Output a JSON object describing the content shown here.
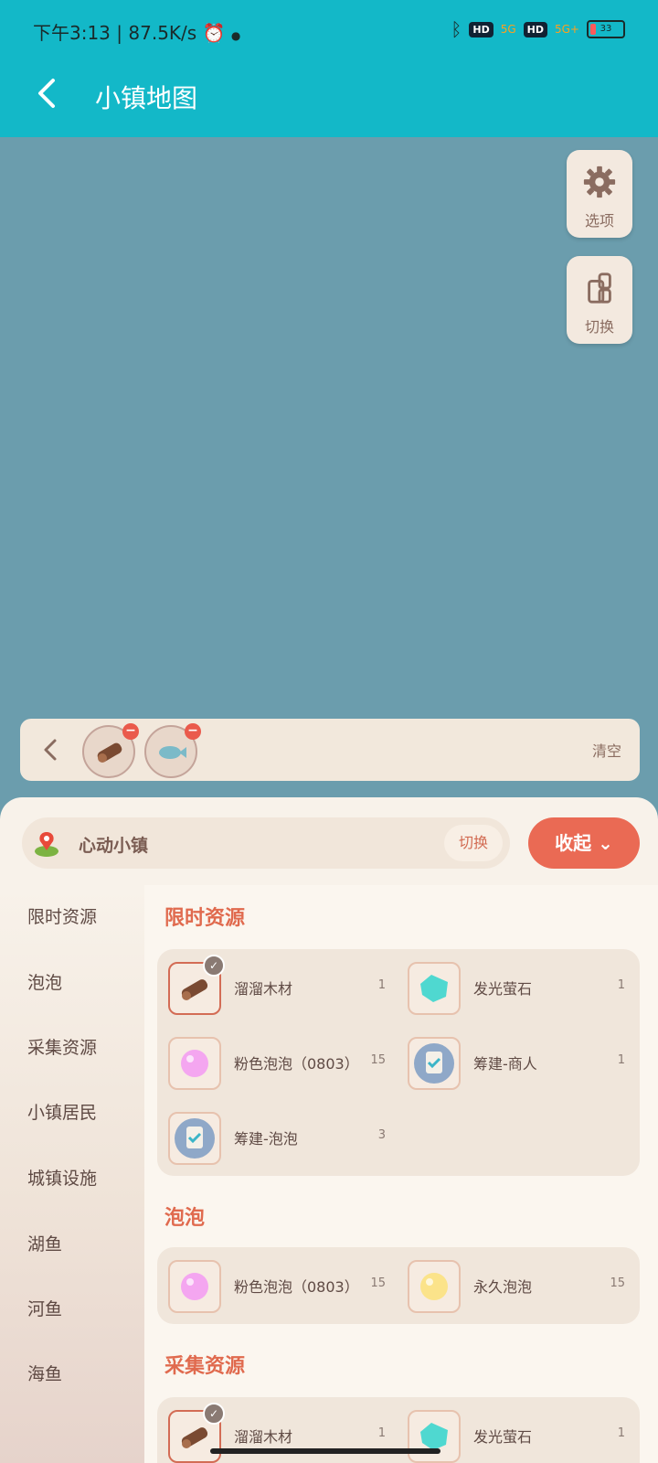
{
  "status": {
    "time": "下午3:13",
    "speed": "87.5K/s",
    "battery": "33",
    "hd1": "HD",
    "hd2": "HD",
    "net1": "5G",
    "net2": "5G+"
  },
  "header": {
    "title": "小镇地图"
  },
  "fab": {
    "options_label": "选项",
    "switch_label": "切换"
  },
  "selection": {
    "clear_label": "清空"
  },
  "town": {
    "name": "心动小镇",
    "switch_label": "切换",
    "collapse_label": "收起"
  },
  "sidebar": {
    "items": [
      "限时资源",
      "泡泡",
      "采集资源",
      "小镇居民",
      "城镇设施",
      "湖鱼",
      "河鱼",
      "海鱼"
    ]
  },
  "sections": [
    {
      "title": "限时资源",
      "items": [
        {
          "name": "溜溜木材",
          "count": "1",
          "icon": "wood-icon",
          "selected": true
        },
        {
          "name": "发光萤石",
          "count": "1",
          "icon": "gem-icon",
          "selected": false
        },
        {
          "name": "粉色泡泡（0803）",
          "count": "15",
          "icon": "pink-bubble-icon",
          "selected": false
        },
        {
          "name": "筹建-商人",
          "count": "1",
          "icon": "clipboard-icon",
          "selected": false
        },
        {
          "name": "筹建-泡泡",
          "count": "3",
          "icon": "clipboard-icon",
          "selected": false
        }
      ]
    },
    {
      "title": "泡泡",
      "items": [
        {
          "name": "粉色泡泡（0803）",
          "count": "15",
          "icon": "pink-bubble-icon",
          "selected": false
        },
        {
          "name": "永久泡泡",
          "count": "15",
          "icon": "yellow-bubble-icon",
          "selected": false
        }
      ]
    },
    {
      "title": "采集资源",
      "items": [
        {
          "name": "溜溜木材",
          "count": "1",
          "icon": "wood-icon",
          "selected": true
        },
        {
          "name": "发光萤石",
          "count": "1",
          "icon": "gem-icon",
          "selected": false
        }
      ]
    }
  ],
  "colors": {
    "primary": "#13b8c8",
    "accent": "#ea6a54",
    "sheet": "#f8f2ea"
  }
}
